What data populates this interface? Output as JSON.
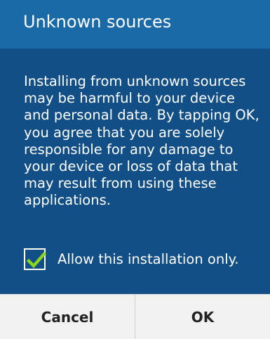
{
  "dialog": {
    "title": "Unknown sources",
    "message": "Installing from unknown sources may be harmful to your device and personal data. By tapping OK, you agree that you are solely responsible for any damage to your device or loss of data that may result from using these applications.",
    "checkbox": {
      "label": "Allow this installation only.",
      "checked": true
    },
    "buttons": {
      "cancel_label": "Cancel",
      "ok_label": "OK"
    }
  },
  "colors": {
    "title_bar": "#1b6aa8",
    "body_bg": "#114f86",
    "check_mark": "#8bd420",
    "button_bar": "#f2f2f2"
  }
}
